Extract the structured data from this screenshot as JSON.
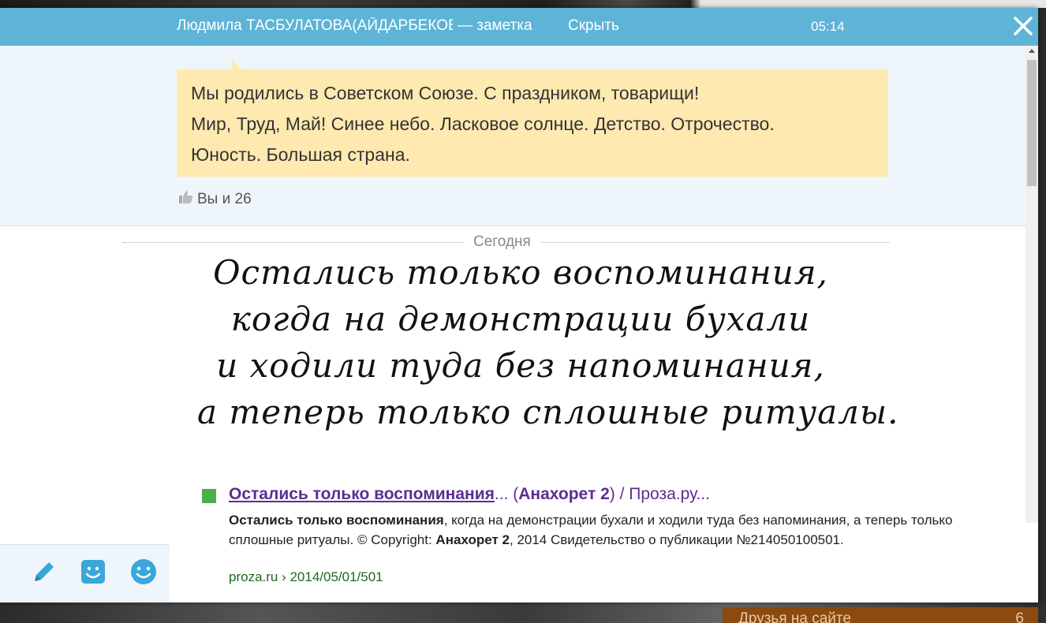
{
  "titlebar": {
    "author": "Людмила ТАСБУЛАТОВА(АЙДАРБЕКОВА)",
    "separator": "— заметка",
    "hide_label": "Скрыть",
    "time": "05:14"
  },
  "note": {
    "lines": [
      "Мы родились в Советском Союзе. С праздником, товарищи!",
      "Мир, Труд, Май! Синее небо. Ласковое солнце. Детство. Отрочество.",
      "Юность. Большая страна."
    ],
    "likes": "Вы и 26"
  },
  "date_separator": "Сегодня",
  "poem": [
    "Остались только воспоминания,",
    "когда на демонстрации бухали",
    "и ходили туда без напоминания,",
    "а теперь только сплошные ритуалы."
  ],
  "search_result": {
    "title_bold_1": "Остались только воспоминания",
    "title_plain_1": "... (",
    "title_bold_2": "Анахорет 2",
    "title_plain_2": ") / Проза.ру...",
    "snippet_bold_1": "Остались только воспоминания",
    "snippet_plain_1": ", когда на демонстрации бухали и ходили туда без напоминания, а теперь только сплошные ритуалы. © Copyright: ",
    "snippet_bold_2": "Анахорет 2",
    "snippet_plain_2": ", 2014 Свидетельство о публикации №214050100501.",
    "url": "proza.ru › 2014/05/01/501"
  },
  "background": {
    "friends_label": "Друзья на сайте",
    "friends_count": "6"
  },
  "colors": {
    "titlebar": "#5eb4d6",
    "bubble": "#fee9b0",
    "note_bg": "#eef6fb",
    "link_visited": "#5c2d91",
    "url_green": "#1d6a1d",
    "bullet_green": "#4cae4c",
    "icon_blue": "#3aa7d8"
  },
  "icons": {
    "close": "close-icon",
    "like": "thumbs-up-icon",
    "toolbar": [
      "pencil-icon",
      "sticker-icon",
      "smiley-icon"
    ]
  }
}
